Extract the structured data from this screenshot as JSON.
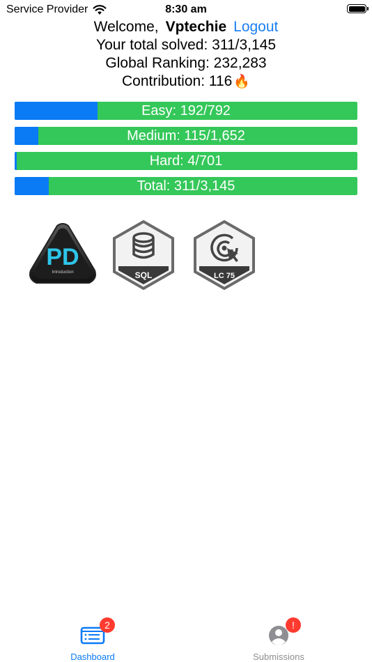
{
  "status_bar": {
    "carrier": "Service Provider",
    "time": "8:30 am"
  },
  "header": {
    "welcome_label": "Welcome,",
    "username": "Vptechie",
    "logout_label": "Logout",
    "total_solved": "Your total solved: 311/3,145",
    "global_ranking": "Global Ranking: 232,283",
    "contribution": "Contribution: 116",
    "contribution_icon": "fire-icon"
  },
  "colors": {
    "solved": "#0a7af5",
    "remaining": "#34c759",
    "link": "#1a7ff2",
    "tab_active": "#0a7af5",
    "tab_inactive": "#8e8e93",
    "badge": "#ff3b30"
  },
  "progress": [
    {
      "label": "Easy: 192/792",
      "solved": 192,
      "total": 792
    },
    {
      "label": "Medium: 115/1,652",
      "solved": 115,
      "total": 1652
    },
    {
      "label": "Hard: 4/701",
      "solved": 4,
      "total": 701
    },
    {
      "label": "Total: 311/3,145",
      "solved": 311,
      "total": 3145
    }
  ],
  "badges": [
    {
      "icon": "pd-introduction-badge-icon",
      "title": "PD",
      "subtitle": "Introduction"
    },
    {
      "icon": "sql-badge-icon",
      "title": "SQL"
    },
    {
      "icon": "lc75-badge-icon",
      "title": "LC 75"
    }
  ],
  "tabbar": {
    "dashboard": {
      "label": "Dashboard",
      "badge": "2",
      "icon": "dashboard-icon"
    },
    "submissions": {
      "label": "Submissions",
      "badge": "!",
      "icon": "person-icon"
    }
  }
}
